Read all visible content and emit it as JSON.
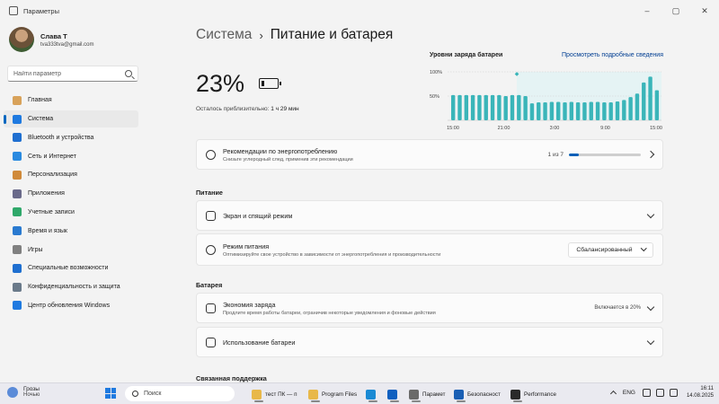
{
  "window": {
    "title": "Параметры",
    "buttons": {
      "minimize": "–",
      "maximize": "▢",
      "close": "✕"
    }
  },
  "profile": {
    "name": "Слава Т",
    "email": "tva333tva@gmail.com"
  },
  "search": {
    "placeholder": "Найти параметр"
  },
  "nav": {
    "items": [
      {
        "label": "Главная",
        "icon": "home-icon",
        "color": "#d8a25a"
      },
      {
        "label": "Система",
        "icon": "system-icon",
        "color": "#1f7ae0",
        "active": true
      },
      {
        "label": "Bluetooth и устройства",
        "icon": "bluetooth-icon",
        "color": "#1f6fd0"
      },
      {
        "label": "Сеть и Интернет",
        "icon": "network-icon",
        "color": "#2a8ae0"
      },
      {
        "label": "Персонализация",
        "icon": "brush-icon",
        "color": "#d08a3a"
      },
      {
        "label": "Приложения",
        "icon": "apps-icon",
        "color": "#6a6a8a"
      },
      {
        "label": "Учетные записи",
        "icon": "accounts-icon",
        "color": "#2fa86a"
      },
      {
        "label": "Время и язык",
        "icon": "time-language-icon",
        "color": "#2a7ad0"
      },
      {
        "label": "Игры",
        "icon": "gaming-icon",
        "color": "#808080"
      },
      {
        "label": "Специальные возможности",
        "icon": "accessibility-icon",
        "color": "#1f6fd0"
      },
      {
        "label": "Конфиденциальность и защита",
        "icon": "privacy-shield-icon",
        "color": "#6a7a8a"
      },
      {
        "label": "Центр обновления Windows",
        "icon": "windows-update-icon",
        "color": "#1f7ae0"
      }
    ]
  },
  "breadcrumb": {
    "parent": "Система",
    "separator": "›",
    "current": "Питание и батарея"
  },
  "battery": {
    "percent_label": "23%",
    "level": 0.23,
    "remaining_prefix": "Осталось приблизительно:",
    "remaining_value": "1 ч 29 мин"
  },
  "chart_data": {
    "type": "bar",
    "title": "Уровни заряда батареи",
    "link": "Просмотреть подробные сведения",
    "y_ticks": [
      "100%",
      "50%"
    ],
    "x_ticks": [
      "15:00",
      "21:00",
      "3:00",
      "9:00",
      "15:00"
    ],
    "ylim": [
      0,
      100
    ],
    "values": [
      52,
      52,
      52,
      52,
      52,
      52,
      52,
      52,
      50,
      52,
      52,
      50,
      35,
      37,
      37,
      38,
      38,
      37,
      38,
      37,
      37,
      38,
      38,
      37,
      37,
      39,
      42,
      48,
      55,
      78,
      90,
      62
    ],
    "bar_color": "#3ab5b9",
    "highlight_color": "#e5f3f4",
    "highlight_marker": "◆"
  },
  "recommendations": {
    "title": "Рекомендации по энергопотреблению",
    "subtitle": "Снизьте углеродный след, применив эти рекомендации",
    "counter": "1 из 7",
    "progress": 0.14
  },
  "sections": {
    "power": "Питание",
    "battery": "Батарея",
    "related": "Связанная поддержка"
  },
  "screen_sleep": {
    "title": "Экран и спящий режим"
  },
  "power_mode": {
    "title": "Режим питания",
    "subtitle": "Оптимизируйте свое устройство в зависимости от энергопотребления и производительности",
    "value": "Сбалансированный"
  },
  "battery_saver": {
    "title": "Экономия заряда",
    "subtitle": "Продлите время работы батареи, ограничив некоторые уведомления и фоновые действия",
    "status": "Включается в 20%"
  },
  "battery_usage": {
    "title": "Использование батареи"
  },
  "taskbar": {
    "weather_title": "Грозы",
    "weather_sub": "Ночью",
    "search_label": "Поиск",
    "apps": [
      {
        "label": "тест ПК — п",
        "color": "#e8b84a"
      },
      {
        "label": "Program Files",
        "color": "#e8b84a"
      },
      {
        "label": "",
        "color": "#1a8ad4"
      },
      {
        "label": "",
        "color": "#1060c0"
      },
      {
        "label": "Парамет",
        "color": "#6a6a6a"
      },
      {
        "label": "Безопасност",
        "color": "#1a5fb4"
      },
      {
        "label": "Performance",
        "color": "#2a2a2a"
      }
    ],
    "lang": "ENG",
    "time": "16:11",
    "date": "14.08.2025"
  }
}
